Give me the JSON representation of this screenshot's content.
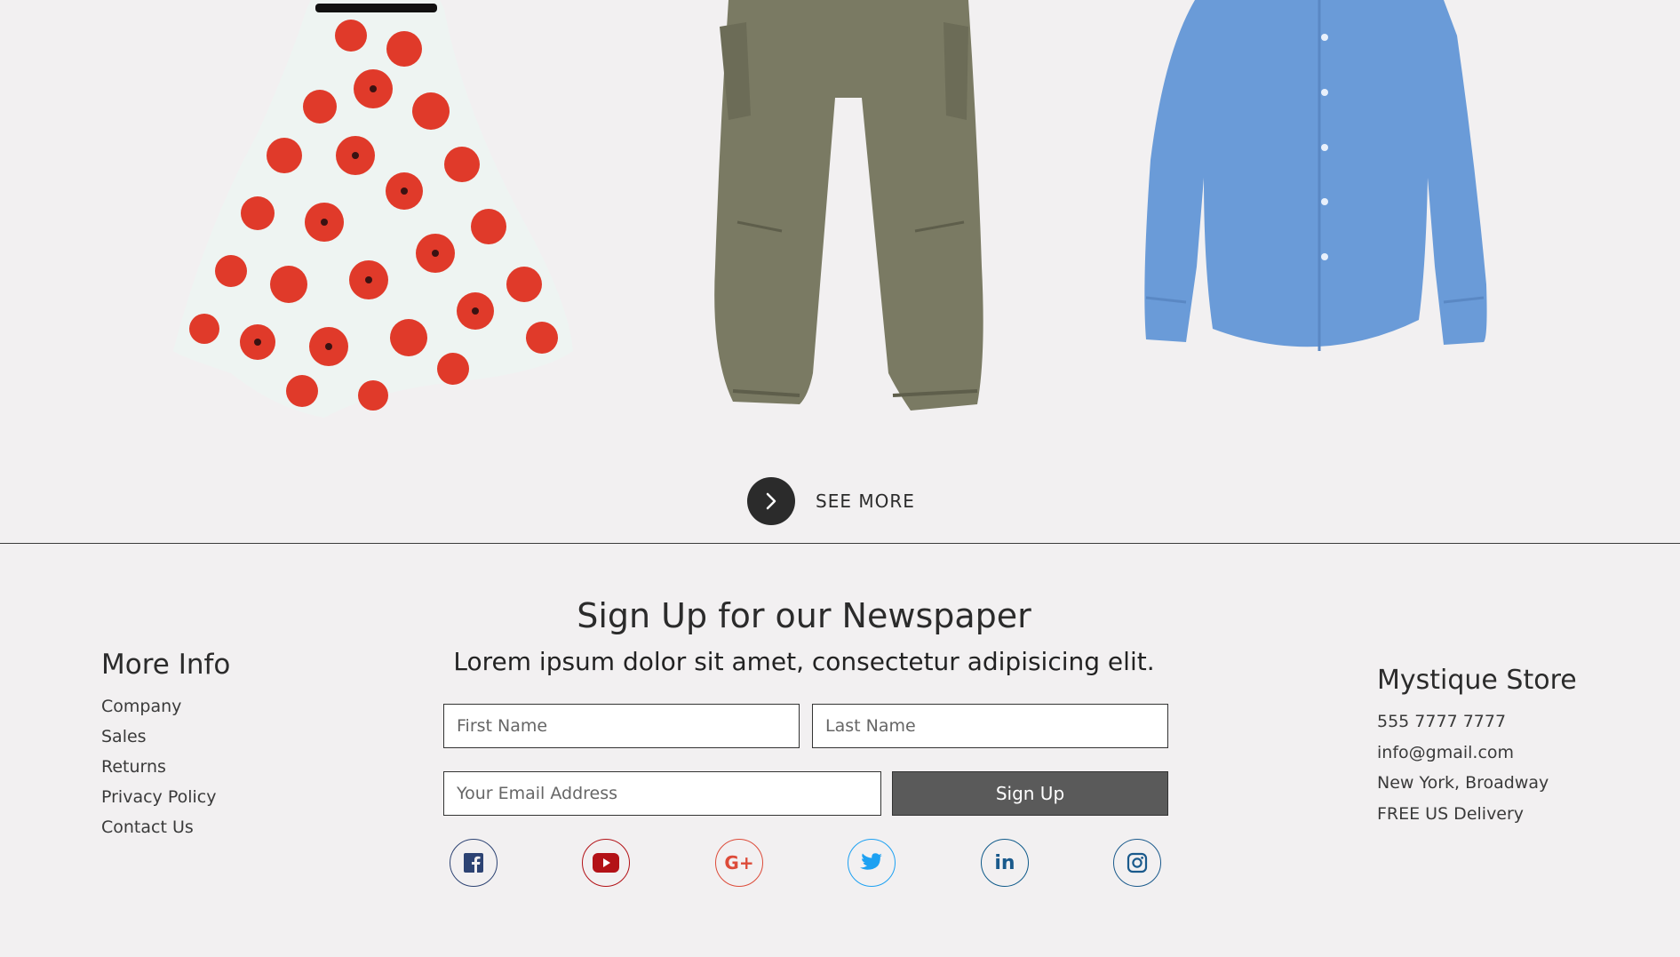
{
  "products": [
    {
      "name": "red-floral-dress-image"
    },
    {
      "name": "olive-cargo-pants-image"
    },
    {
      "name": "blue-shirt-image"
    }
  ],
  "see_more": {
    "label": "SEE MORE",
    "icon": "chevron-right-icon"
  },
  "more_info": {
    "title": "More Info",
    "links": [
      "Company",
      "Sales",
      "Returns",
      "Privacy Policy",
      "Contact Us"
    ]
  },
  "newsletter": {
    "title": "Sign Up for our Newspaper",
    "subtitle": "Lorem ipsum dolor sit amet, consectetur adipisicing elit.",
    "first_name_placeholder": "First Name",
    "last_name_placeholder": "Last Name",
    "email_placeholder": "Your Email Address",
    "button_label": "Sign Up"
  },
  "social": [
    {
      "icon": "facebook-icon",
      "color": "#2d4373"
    },
    {
      "icon": "youtube-icon",
      "color": "#b31217"
    },
    {
      "icon": "google-plus-icon",
      "color": "#dd4b39",
      "text": "G+"
    },
    {
      "icon": "twitter-icon",
      "color": "#1da1f2"
    },
    {
      "icon": "linkedin-icon",
      "color": "#1a5a8c",
      "text": "in"
    },
    {
      "icon": "instagram-icon",
      "color": "#1a5a8c"
    }
  ],
  "store": {
    "title": "Mystique Store",
    "phone": "555 7777 7777",
    "email": "info@gmail.com",
    "address": "New York, Broadway",
    "delivery": "FREE US Delivery"
  },
  "colors": {
    "background": "#f2f0f1",
    "text": "#2b2b2b",
    "button": "#5a5a5a"
  }
}
